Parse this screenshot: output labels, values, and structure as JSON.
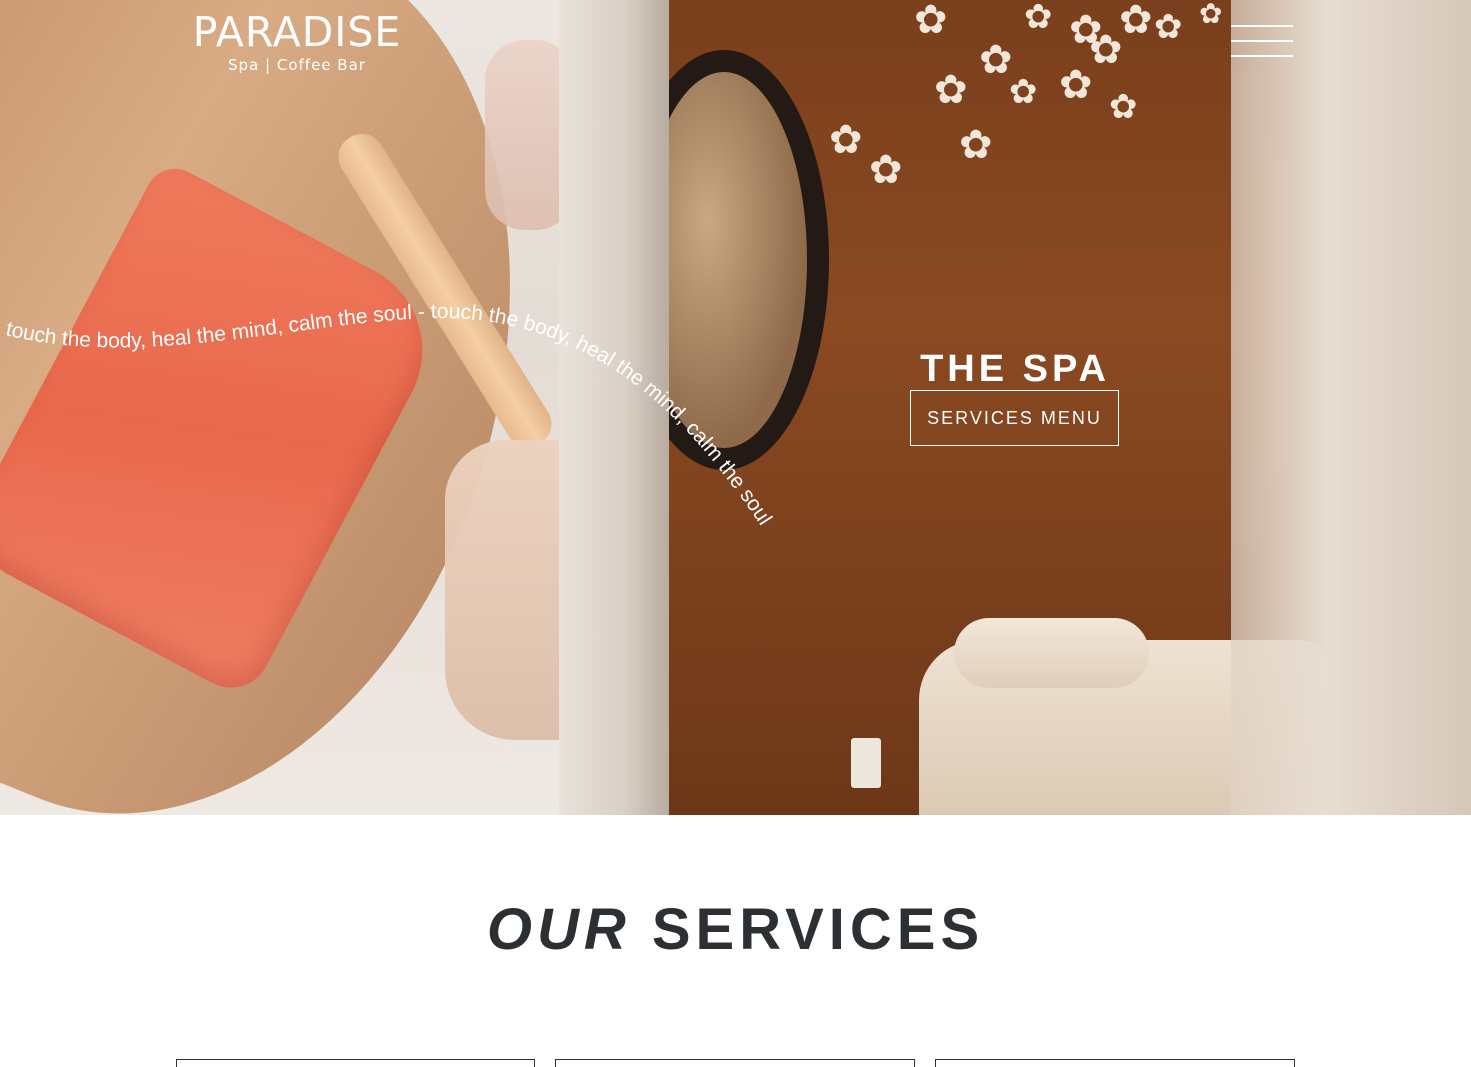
{
  "brand": {
    "name": "PARADISE",
    "tagline": "Spa | Coffee Bar"
  },
  "nav": {
    "menu_icon": "hamburger-icon"
  },
  "hero": {
    "curved_text": "touch the body, heal the mind, calm the soul - touch the body, heal the mind, calm the soul",
    "title": "THE SPA",
    "cta_label": "SERVICES MENU"
  },
  "services": {
    "heading_em": "OUR",
    "heading_rest": "SERVICES"
  },
  "colors": {
    "heading_text": "#2d3033",
    "wax": "#e9694d",
    "wall": "#7a3f1c"
  }
}
